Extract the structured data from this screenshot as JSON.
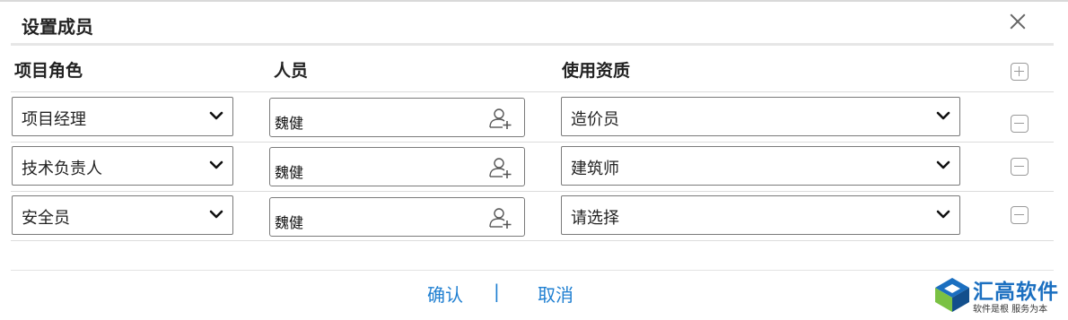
{
  "dialog": {
    "title": "设置成员"
  },
  "columns": {
    "role": "项目角色",
    "person": "人员",
    "qualification": "使用资质"
  },
  "rows": [
    {
      "role": "项目经理",
      "person": "魏健",
      "qualification": "造价员"
    },
    {
      "role": "技术负责人",
      "person": "魏健",
      "qualification": "建筑师"
    },
    {
      "role": "安全员",
      "person": "魏健",
      "qualification": "请选择"
    }
  ],
  "footer": {
    "confirm": "确认",
    "separator": "|",
    "cancel": "取消"
  },
  "logo": {
    "brand": "汇高软件",
    "slogan": "软件是根 服务为本"
  },
  "icons": {
    "close": "close-icon",
    "add_row": "plus-square-icon",
    "remove_row": "minus-square-icon",
    "dropdown": "chevron-down-icon",
    "add_person": "add-person-icon"
  },
  "colors": {
    "link": "#1f7fd1",
    "brand": "#1b6fc0",
    "logo_green": "#7ac143"
  }
}
